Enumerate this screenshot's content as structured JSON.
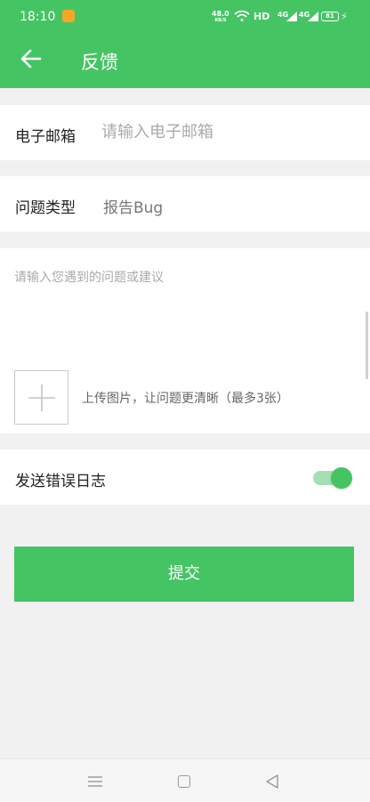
{
  "status_bar": {
    "time": "18:10",
    "net_speed_value": "48.0",
    "net_speed_unit": "KB/S",
    "hd_label": "HD",
    "network1": "4G",
    "network2": "4G",
    "battery": "81",
    "icons": [
      "app-notification-icon",
      "wifi-icon",
      "signal-icon",
      "battery-icon",
      "charging-icon"
    ]
  },
  "app_bar": {
    "title": "反馈",
    "back_icon": "arrow-left-icon"
  },
  "form": {
    "email": {
      "label": "电子邮箱",
      "placeholder": "请输入电子邮箱",
      "value": ""
    },
    "problem_type": {
      "label": "问题类型",
      "value": "报告Bug"
    },
    "feedback": {
      "placeholder": "请输入您遇到的问题或建议",
      "value": ""
    },
    "upload": {
      "hint": "上传图片，让问题更清晰（最多3张）",
      "icon": "plus-icon"
    },
    "send_log": {
      "label": "发送错误日志",
      "enabled": true
    },
    "submit_label": "提交"
  },
  "nav_bar": {
    "icons": [
      "menu-icon",
      "home-icon",
      "back-triangle-icon"
    ]
  },
  "colors": {
    "primary": "#45c464",
    "switch_track": "#a5dfb3",
    "background": "#f1f1f1"
  }
}
